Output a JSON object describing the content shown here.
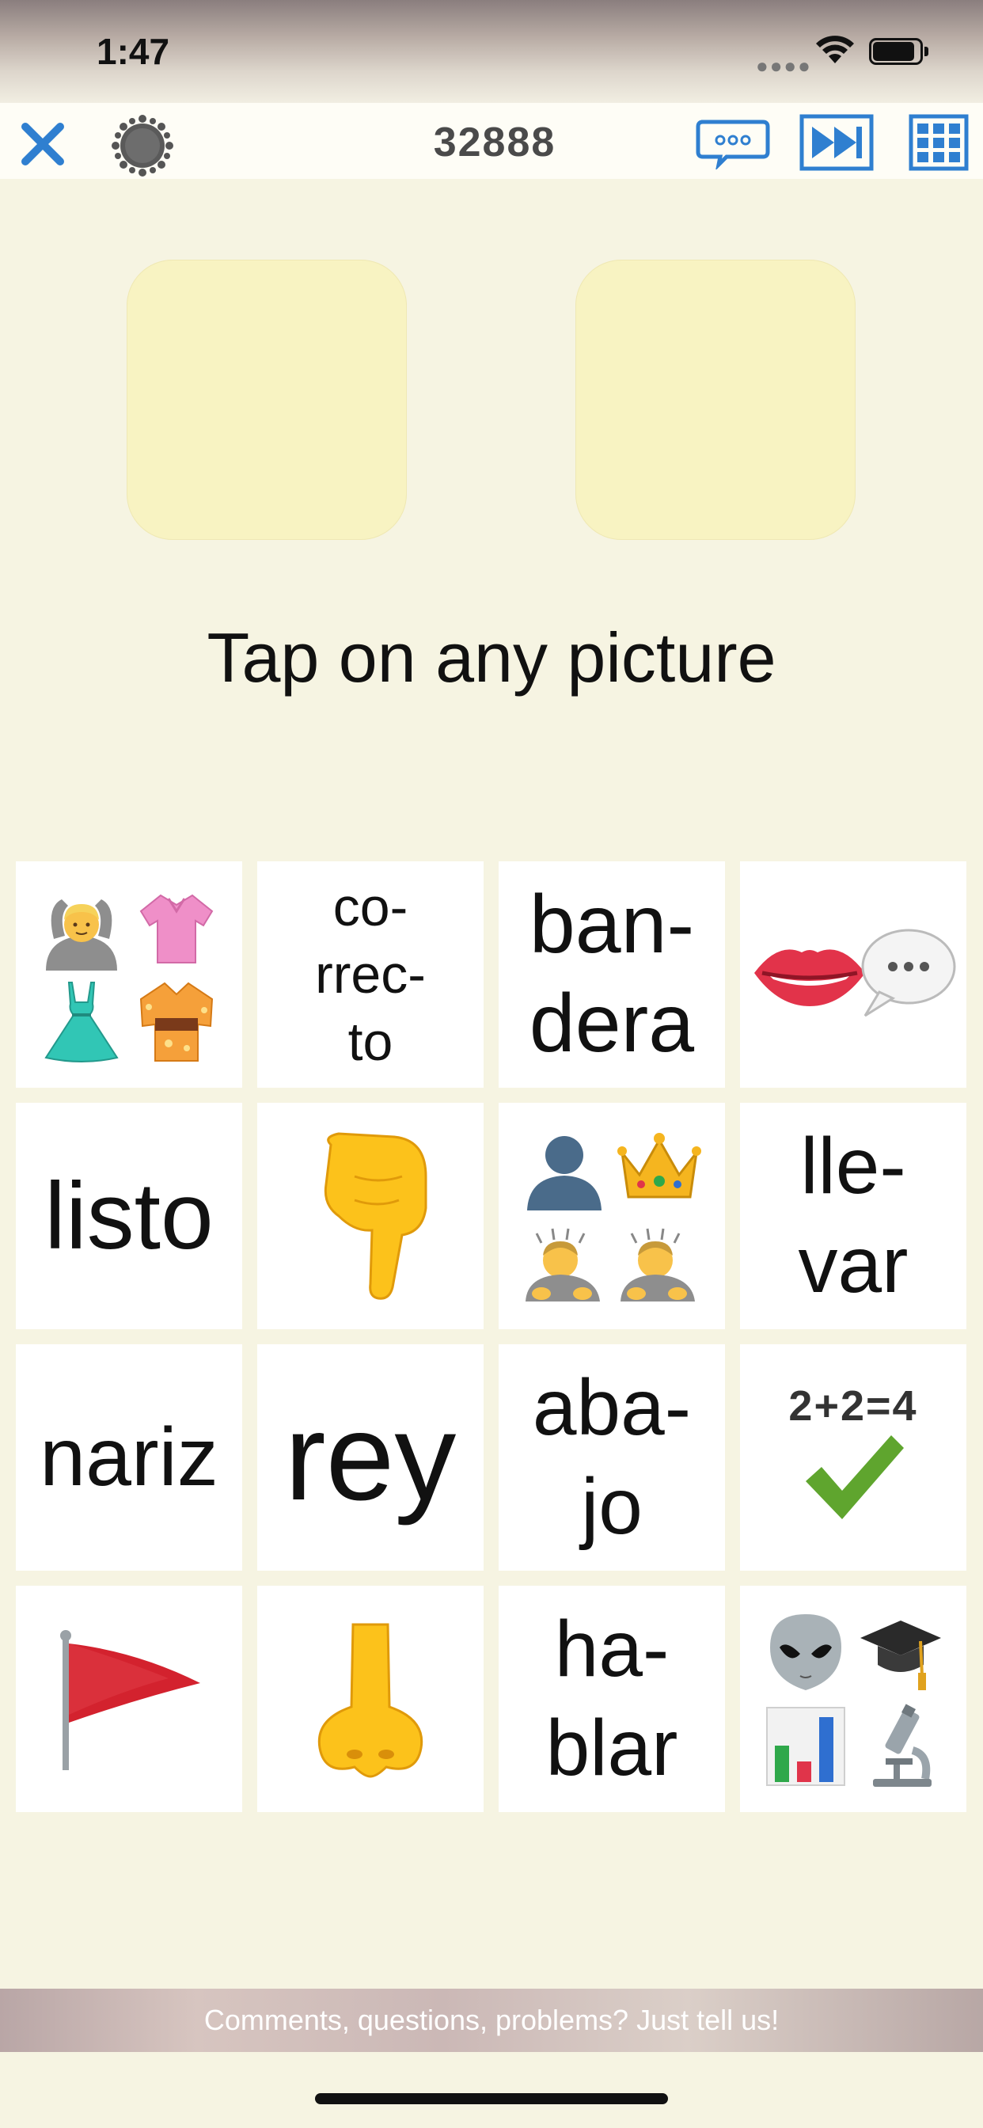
{
  "status_bar": {
    "time": "1:47",
    "icons": [
      "cellular-dots-icon",
      "wifi-icon",
      "battery-icon"
    ]
  },
  "toolbar": {
    "score": "32888",
    "icons": [
      "close-icon",
      "settings-icon",
      "chat-icon",
      "fast-forward-icon",
      "grid-icon"
    ],
    "accent_color": "#2f7fd0"
  },
  "instruction": "Tap on any picture",
  "tiles": [
    {
      "type": "emoji",
      "icons": [
        "person-gesturing-ok-icon",
        "blouse-icon",
        "dress-icon",
        "kimono-icon"
      ]
    },
    {
      "type": "word",
      "text": "co-\nrrec-\nto"
    },
    {
      "type": "word",
      "text": "ban-\ndera"
    },
    {
      "type": "emoji",
      "icons": [
        "lips-icon",
        "speech-bubble-icon"
      ]
    },
    {
      "type": "word",
      "text": "listo"
    },
    {
      "type": "emoji",
      "icons": [
        "pointing-down-icon"
      ]
    },
    {
      "type": "emoji",
      "icons": [
        "person-silhouette-icon",
        "crown-icon",
        "bowing-person-icon",
        "bowing-person-icon"
      ]
    },
    {
      "type": "word",
      "text": "lle-\nvar"
    },
    {
      "type": "word",
      "text": "nariz"
    },
    {
      "type": "word",
      "text": "rey"
    },
    {
      "type": "word",
      "text": "aba-\njo"
    },
    {
      "type": "emoji",
      "icons": [
        "math-check-icon"
      ],
      "caption": "2+2=4"
    },
    {
      "type": "emoji",
      "icons": [
        "red-flag-icon"
      ]
    },
    {
      "type": "emoji",
      "icons": [
        "nose-icon"
      ]
    },
    {
      "type": "word",
      "text": "ha-\nblar"
    },
    {
      "type": "emoji",
      "icons": [
        "alien-icon",
        "graduation-cap-icon",
        "bar-chart-icon",
        "microscope-icon"
      ]
    }
  ],
  "footer": {
    "text": "Comments, questions, problems? Just tell us!"
  }
}
